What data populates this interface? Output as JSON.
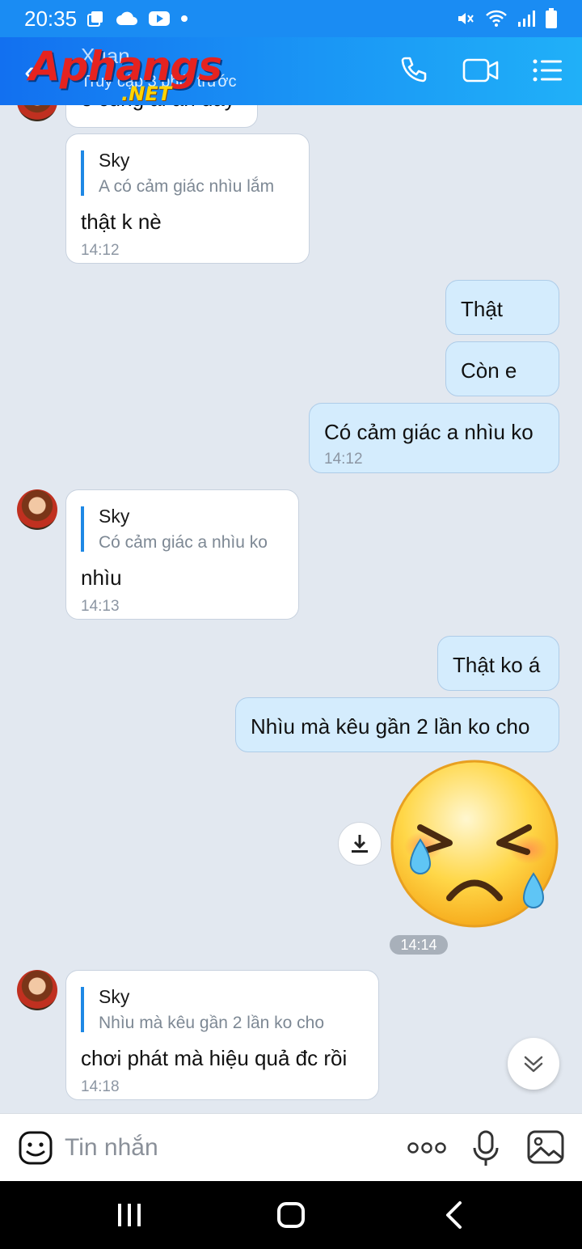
{
  "status_bar": {
    "time": "20:35",
    "left_icons": [
      "copy-notification-icon",
      "cloud-icon",
      "youtube-icon",
      "dot-icon"
    ],
    "right_icons": [
      "mute-icon",
      "wifi-icon",
      "signal-icon",
      "battery-icon"
    ]
  },
  "header": {
    "contact_name": "Xuan",
    "last_seen": "Truy cập 3 phút trước",
    "watermark_logo": "Aphangs",
    "watermark_domain": ".NET",
    "actions": [
      "phone-icon",
      "video-call-icon",
      "menu-icon"
    ],
    "accent": "#1a8cf3"
  },
  "messages": [
    {
      "side": "in",
      "text": "e cũng ai ăn đây",
      "partial": true
    },
    {
      "side": "in",
      "quote": {
        "author": "Sky",
        "text": "A có cảm giác nhìu lắm"
      },
      "text": "thật k nè",
      "time": "14:12"
    },
    {
      "side": "out",
      "text": "Thật"
    },
    {
      "side": "out",
      "text": "Còn e"
    },
    {
      "side": "out",
      "text": "Có cảm giác a nhìu ko",
      "time": "14:12"
    },
    {
      "side": "in",
      "quote": {
        "author": "Sky",
        "text": "Có cảm giác a nhìu ko"
      },
      "text": "nhìu",
      "time": "14:13"
    },
    {
      "side": "out",
      "text": "Thật ko á"
    },
    {
      "side": "out",
      "text": "Nhìu mà kêu gần 2 lần ko cho"
    },
    {
      "side": "out",
      "type": "sticker",
      "sticker": "crying-angry-emoji",
      "time": "14:14"
    },
    {
      "side": "in",
      "quote": {
        "author": "Sky",
        "text": "Nhìu mà kêu gần 2 lần ko cho"
      },
      "text": "chơi phát mà hiệu quả đc rồi",
      "time": "14:18"
    }
  ],
  "input": {
    "placeholder": "Tin nhắn",
    "value": "",
    "icons": [
      "emoji-icon",
      "more-icon",
      "microphone-icon",
      "image-icon"
    ]
  },
  "nav_bar": {
    "buttons": [
      "recent-apps-icon",
      "home-icon",
      "back-icon"
    ]
  }
}
